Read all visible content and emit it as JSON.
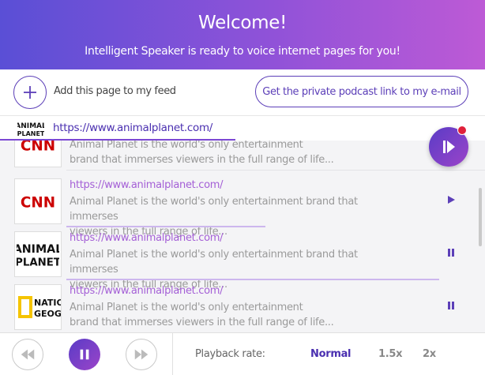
{
  "header": {
    "title": "Welcome!",
    "subtitle": "Intelligent Speaker is ready to voice internet pages for you!"
  },
  "actions": {
    "add_label": "Add this page to my feed",
    "podcast_label": "Get the private podcast link to my e-mail"
  },
  "current_page": {
    "url": "https://www.animalplanet.com/",
    "logo": "animal-planet-logo",
    "progress": 0.485
  },
  "list": {
    "items": [
      {
        "logo": "cnn-logo",
        "logo_text": "CNN",
        "url": "",
        "desc_line1": "Animal Planet is the world's only entertainment",
        "desc_line2": "brand that immerses viewers in the full range of life...",
        "control": "none"
      },
      {
        "logo": "cnn-logo",
        "logo_text": "CNN",
        "url": "https://www.animalplanet.com/",
        "desc_line1": "Animal Planet is the world's only entertainment brand that immerses",
        "desc_line2": "viewers in the full range of life...",
        "control": "play",
        "progress": 0.4
      },
      {
        "logo": "animal-planet-logo",
        "logo_text": "ANIMAL PLANET",
        "url": "https://www.animalplanet.com/",
        "desc_line1": "Animal Planet is the world's only entertainment brand that immerses",
        "desc_line2": "viewers in the full range of life...",
        "control": "pause",
        "progress": 0.97
      },
      {
        "logo": "national-geographic-logo",
        "logo_text": "NATIONAL GEOGRAPHIC",
        "url": "https://www.animalplanet.com/",
        "desc_line1": "Animal Planet is the world's only entertainment",
        "desc_line2": "brand that immerses viewers in the full range of life...",
        "control": "pause"
      }
    ]
  },
  "footer": {
    "rate_label": "Playback rate:",
    "rates": [
      "Normal",
      "1.5x",
      "2x"
    ],
    "active_rate": "Normal"
  },
  "colors": {
    "accent": "#5c3fb8",
    "header_start": "#5a4fd6",
    "header_end": "#bd5ad6",
    "link": "#a45fd6",
    "badge": "#e0203a"
  }
}
